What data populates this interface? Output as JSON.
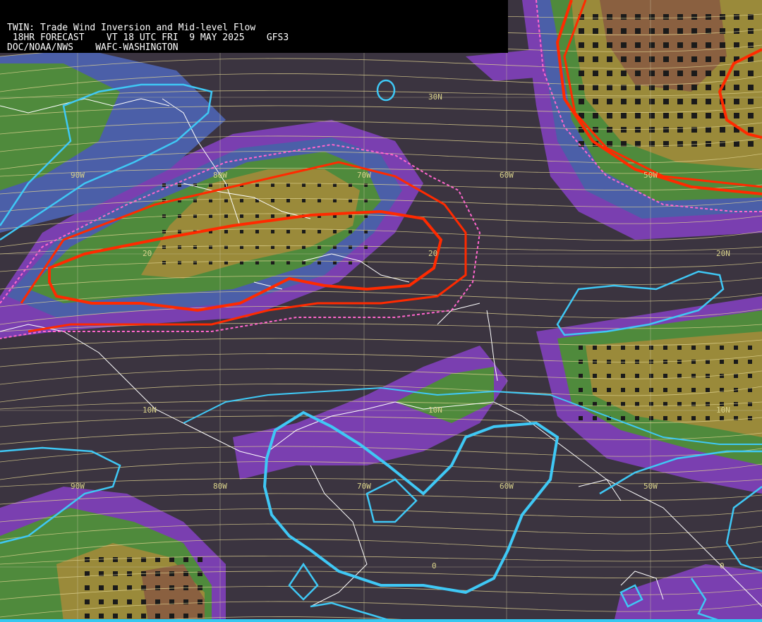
{
  "header": {
    "line1": "TWIN: Trade Wind Inversion and Mid-level Flow",
    "line2": " 18HR FORECAST    VT 18 UTC FRI  9 MAY 2025    GFS3",
    "line3": "DOC/NOAA/NWS    WAFC-WASHINGTON"
  },
  "labels": {
    "lat30": "30N",
    "lat20_left": "20",
    "lat20_mid": "20",
    "lat20_right": "20N",
    "lat10_left": "10N",
    "lat10_mid": "10N",
    "lat10_right": "10N",
    "lat0_mid": "0",
    "lat0_right": "0",
    "lon90_top": "90W",
    "lon80_top": "80W",
    "lon70_top": "70W",
    "lon60_top": "60W",
    "lon50_top": "50W",
    "lon90_bot": "90W",
    "lon80_bot": "80W",
    "lon70_bot": "70W",
    "lon60_bot": "60W",
    "lon50_bot": "50W"
  },
  "colors": {
    "background": "#3b3440",
    "purple": "#7a3fb0",
    "blue": "#4b5fa8",
    "green": "#4f8a3c",
    "olive": "#9a8a3a",
    "brown": "#8a6040",
    "cyan_contour": "#3fc8f5",
    "red_contour": "#ff2a00",
    "pink_dashed": "#ff66cc",
    "streamline": "#e2d592",
    "coastline": "#ffffff"
  }
}
